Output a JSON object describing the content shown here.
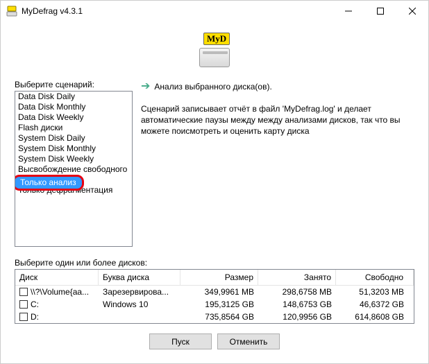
{
  "window": {
    "title": "MyDefrag v4.3.1"
  },
  "logo": {
    "badge": "MyD"
  },
  "labels": {
    "scenario": "Выберите сценарий:",
    "disks": "Выберите один или более дисков:"
  },
  "scenarios": {
    "items": [
      "Data Disk Daily",
      "Data Disk Monthly",
      "Data Disk Weekly",
      "Flash диски",
      "System Disk Daily",
      "System Disk Monthly",
      "System Disk Weekly",
      "Высвобождение свободного",
      "Только анализ",
      "Только дефрагментация"
    ],
    "selected_index": 8
  },
  "description": {
    "header": "Анализ выбранного диска(ов).",
    "body": "Сценарий записывает отчёт в файл 'MyDefrag.log' и делает автоматические паузы между между анализами дисков, так что вы можете поисмотреть и оценить карту диска"
  },
  "disk_table": {
    "headers": {
      "disk": "Диск",
      "letter": "Буква диска",
      "size": "Размер",
      "used": "Занято",
      "free": "Свободно"
    },
    "rows": [
      {
        "disk": "\\\\?\\Volume{aa...",
        "letter": "Зарезервирова...",
        "size": "349,9961 MB",
        "used": "298,6758 MB",
        "free": "51,3203 MB"
      },
      {
        "disk": "C:",
        "letter": "Windows 10",
        "size": "195,3125 GB",
        "used": "148,6753 GB",
        "free": "46,6372 GB"
      },
      {
        "disk": "D:",
        "letter": "",
        "size": "735,8564 GB",
        "used": "120,9956 GB",
        "free": "614,8608 GB"
      }
    ]
  },
  "buttons": {
    "run": "Пуск",
    "cancel": "Отменить"
  }
}
